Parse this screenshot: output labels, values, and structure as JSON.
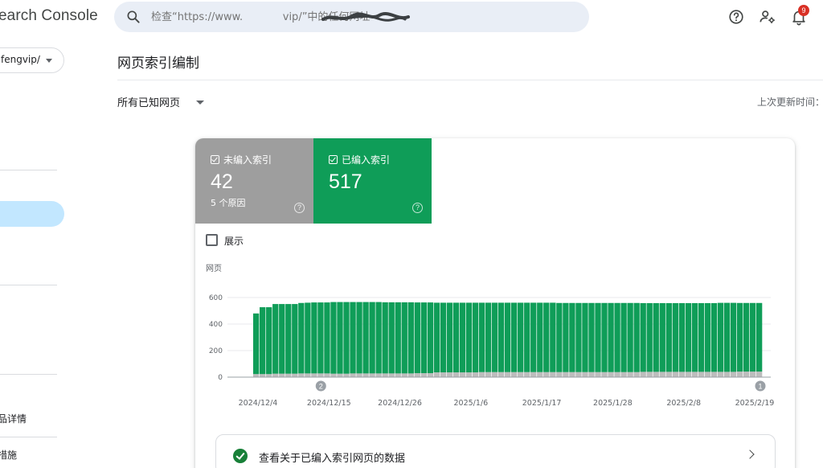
{
  "header": {
    "brand": "earch Console",
    "search_placeholder": "检查“https://www.            vip/”中的任何网址",
    "notification_count": "9",
    "icons": [
      "search-icon",
      "help-icon",
      "manage-users-icon",
      "bell-icon"
    ]
  },
  "sidebar": {
    "property": "fengvip/",
    "items": [
      "品详情",
      "措施"
    ]
  },
  "main": {
    "title": "网页索引编制",
    "filter": "所有已知网页",
    "updated": "上次更新时间："
  },
  "tiles": [
    {
      "label": "未编入索引",
      "count": "42",
      "sub": "5 个原因",
      "color": "#9e9e9e"
    },
    {
      "label": "已编入索引",
      "count": "517",
      "sub": "",
      "color": "#0f9d58"
    }
  ],
  "show_label": "展示",
  "link_text": "查看关于已编入索引网页的数据",
  "chart_data": {
    "type": "bar",
    "stacked": true,
    "ylabel": "网页",
    "ylim": [
      0,
      600
    ],
    "yticks": [
      0,
      200,
      400,
      600
    ],
    "xtick_labels": [
      "2024/12/4",
      "2024/12/15",
      "2024/12/26",
      "2025/1/6",
      "2025/1/17",
      "2025/1/28",
      "2025/2/8",
      "2025/2/19"
    ],
    "x_start": "2024/12/4",
    "series": [
      {
        "name": "未编入索引",
        "color": "#bdbdbd",
        "values": [
          23,
          23,
          23,
          26,
          26,
          26,
          26,
          28,
          28,
          28,
          28,
          28,
          26,
          26,
          26,
          28,
          28,
          28,
          28,
          28,
          28,
          28,
          28,
          28,
          28,
          30,
          30,
          30,
          36,
          36,
          36,
          36,
          36,
          36,
          36,
          38,
          38,
          38,
          38,
          38,
          38,
          38,
          38,
          38,
          38,
          38,
          38,
          38,
          38,
          38,
          38,
          38,
          38,
          38,
          38,
          38,
          38,
          38,
          38,
          38,
          40,
          40,
          40,
          40,
          40,
          40,
          40,
          40,
          40,
          40,
          40,
          40,
          40,
          40,
          40,
          42,
          42,
          42,
          42
        ]
      },
      {
        "name": "已编入索引",
        "color": "#0f9d58",
        "values": [
          457,
          504,
          504,
          525,
          525,
          525,
          525,
          531,
          533,
          535,
          535,
          535,
          540,
          540,
          540,
          538,
          538,
          538,
          538,
          538,
          536,
          536,
          536,
          536,
          536,
          533,
          533,
          533,
          525,
          525,
          525,
          525,
          525,
          525,
          525,
          523,
          523,
          523,
          523,
          523,
          523,
          523,
          523,
          523,
          523,
          523,
          523,
          521,
          521,
          521,
          521,
          521,
          521,
          521,
          521,
          521,
          521,
          521,
          521,
          521,
          518,
          518,
          518,
          518,
          518,
          518,
          518,
          518,
          518,
          518,
          518,
          518,
          520,
          520,
          520,
          517,
          517,
          517,
          517
        ]
      }
    ],
    "annotations": [
      {
        "label": "2",
        "x_date": "2024/12/14"
      },
      {
        "label": "1",
        "x_date": "2025/2/26"
      }
    ]
  }
}
